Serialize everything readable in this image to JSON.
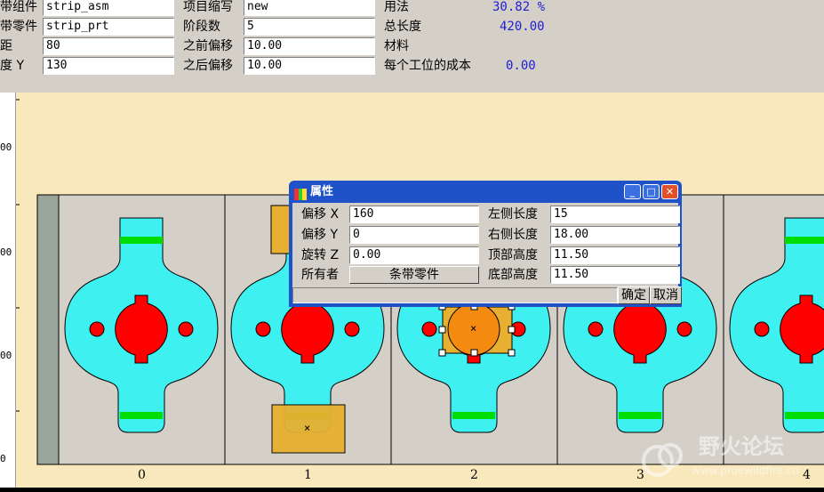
{
  "top_panel": {
    "col1": [
      {
        "label": "带组件",
        "value": "strip_asm"
      },
      {
        "label": "带零件",
        "value": "strip_prt"
      },
      {
        "label": "距",
        "value": "80"
      },
      {
        "label": "度 Y",
        "value": "130"
      }
    ],
    "col2": [
      {
        "label": "项目缩写",
        "value": "new"
      },
      {
        "label": "阶段数",
        "value": "5"
      },
      {
        "label": "之前偏移",
        "value": "10.00"
      },
      {
        "label": "之后偏移",
        "value": "10.00"
      }
    ],
    "col3": [
      {
        "label": "用法",
        "value": "30.82 %"
      },
      {
        "label": "总长度",
        "value": "420.00"
      },
      {
        "label": "材料",
        "value": ""
      },
      {
        "label": "每个工位的成本",
        "value": "0.00"
      }
    ]
  },
  "ruler": {
    "ticks": [
      "00",
      "00",
      "00",
      "0"
    ]
  },
  "stages": [
    "0",
    "1",
    "2",
    "3",
    "4"
  ],
  "dialog": {
    "title": "属性",
    "rows_left": [
      {
        "label": "偏移 X",
        "value": "160"
      },
      {
        "label": "偏移 Y",
        "value": "0"
      },
      {
        "label": "旋转 Z",
        "value": "0.00"
      },
      {
        "label": "所有者",
        "value": "条带零件"
      }
    ],
    "rows_right": [
      {
        "label": "左侧长度",
        "value": "15"
      },
      {
        "label": "右侧长度",
        "value": "18.00"
      },
      {
        "label": "顶部高度",
        "value": "11.50"
      },
      {
        "label": "底部高度",
        "value": "11.50"
      }
    ],
    "ok_label": "确定",
    "cancel_label": "取消",
    "minimize_glyph": "_",
    "maximize_glyph": "□",
    "close_glyph": "✕"
  },
  "watermark": {
    "title": "野火论坛",
    "url": "www.proewildfire.cn"
  },
  "markers": {
    "center_x": "×"
  },
  "colors": {
    "part_cyan": "#3ff0f0",
    "hole_red": "#ff0000",
    "strip_green": "#00dd00",
    "selected_orange": "#f5a020",
    "canvas_bg": "#f8e8bc",
    "title_blue": "#1f52c9"
  }
}
